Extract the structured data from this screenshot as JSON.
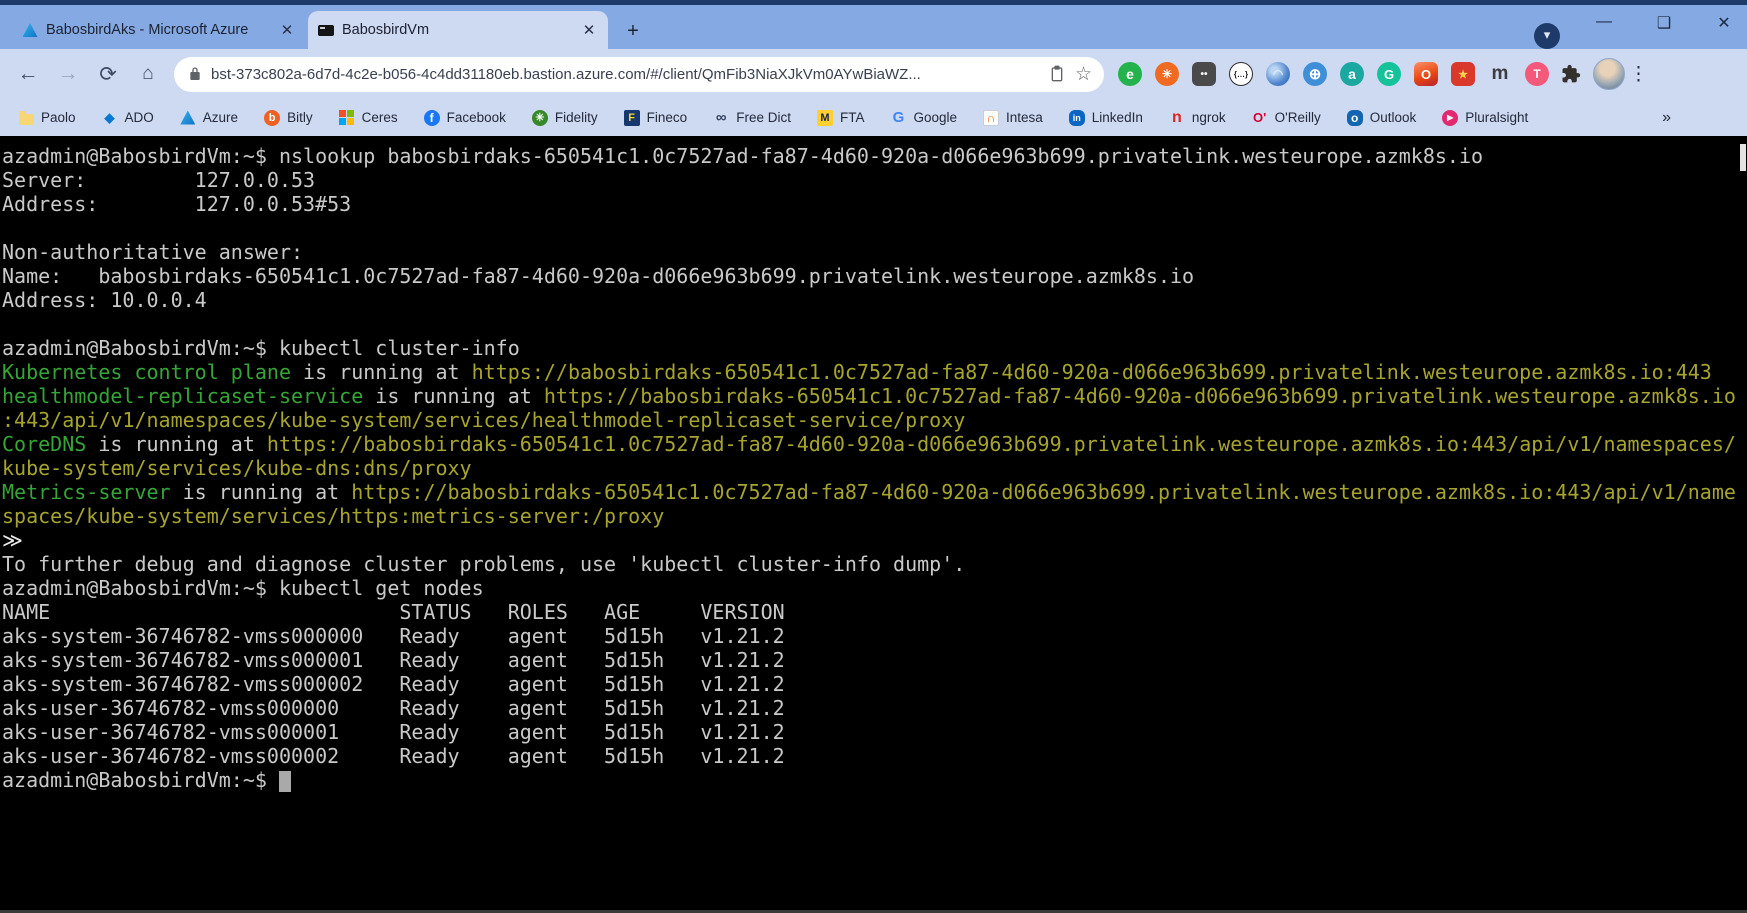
{
  "browser": {
    "tabs": [
      {
        "title": "BabosbirdAks - Microsoft Azure",
        "favicon": "azure",
        "close_glyph": "✕",
        "active": false
      },
      {
        "title": "BabosbirdVm",
        "favicon": "terminal",
        "close_glyph": "✕",
        "active": true
      }
    ],
    "new_tab_glyph": "+",
    "tab_search_glyph": "▾",
    "window_controls": {
      "minimize": "—",
      "maximize": "❑",
      "close": "✕"
    },
    "toolbar": {
      "back_glyph": "←",
      "forward_glyph": "→",
      "reload_glyph": "⟳",
      "home_glyph": "⌂",
      "url": "bst-373c802a-6d7d-4c2e-b056-4c4dd31180eb.bastion.azure.com/#/client/QmFib3NiaXJkVm0AYwBiaWZ...",
      "star_glyph": "☆"
    },
    "extensions": [
      {
        "name": "evernote-extension-icon",
        "glyph": "e",
        "bg": "#23b24b",
        "fg": "#ffffff",
        "shape": "circle",
        "size": 14
      },
      {
        "name": "orange-burst-extension-icon",
        "glyph": "✳",
        "bg": "#f06a21",
        "fg": "#ffffff",
        "shape": "circle",
        "size": 12
      },
      {
        "name": "dark-capture-extension-icon",
        "glyph": "••",
        "bg": "#4a4a4a",
        "fg": "#ffffff",
        "shape": "rounded",
        "size": 10
      },
      {
        "name": "json-formatter-extension-icon",
        "glyph": "{…}",
        "bg": "#ffffff",
        "fg": "#222222",
        "shape": "circle",
        "size": 8,
        "border": "#2b2b2b"
      },
      {
        "name": "blue-swirl-extension-icon",
        "glyph": "◠",
        "bg": "#5a90d6",
        "fg": "#dce9fa",
        "shape": "circle",
        "size": 12,
        "grad": "radial-gradient(circle at 35% 35%,#bcd6f2 15%,#4f86cf 60%,#2e5fa8)"
      },
      {
        "name": "globe-download-extension-icon",
        "glyph": "⊕",
        "bg": "#3f8fd8",
        "fg": "#ffffff",
        "shape": "circle",
        "size": 15
      },
      {
        "name": "teal-a-extension-icon",
        "glyph": "a",
        "bg": "#1ba8a0",
        "fg": "#ffffff",
        "shape": "circle",
        "size": 14
      },
      {
        "name": "grammarly-extension-icon",
        "glyph": "G",
        "bg": "#15c39a",
        "fg": "#ffffff",
        "shape": "circle",
        "size": 13
      },
      {
        "name": "office-extension-icon",
        "glyph": "O",
        "bg": "#d83b01",
        "fg": "#ffffff",
        "shape": "rounded",
        "size": 13,
        "grad": "linear-gradient(160deg,#ff8f6b,#e8490f 55%,#b72130)"
      },
      {
        "name": "red-folder-star-extension-icon",
        "glyph": "★",
        "bg": "#d9382a",
        "fg": "#ffd34d",
        "shape": "rounded",
        "size": 11
      },
      {
        "name": "medium-m-extension-icon",
        "glyph": "m",
        "bg": "transparent",
        "fg": "#3c3c43",
        "shape": "none",
        "size": 19
      },
      {
        "name": "pink-t-extension-icon",
        "glyph": "T",
        "bg": "#f4587a",
        "fg": "#ffffff",
        "shape": "circle",
        "size": 12
      }
    ],
    "bookmarks": {
      "items": [
        {
          "label": "Paolo",
          "type": "folder"
        },
        {
          "label": "ADO",
          "type": "plain",
          "glyph": "◆",
          "bg": "transparent",
          "fg": "#0078d4",
          "size": 13
        },
        {
          "label": "Azure",
          "type": "azure"
        },
        {
          "label": "Bitly",
          "type": "plain",
          "glyph": "b",
          "bg": "#ee6123",
          "fg": "#ffffff",
          "shape": "circle",
          "size": 11
        },
        {
          "label": "Ceres",
          "type": "mssquares"
        },
        {
          "label": "Facebook",
          "type": "plain",
          "glyph": "f",
          "bg": "#1877f2",
          "fg": "#ffffff",
          "shape": "circle",
          "size": 12
        },
        {
          "label": "Fidelity",
          "type": "plain",
          "glyph": "✳",
          "bg": "#368727",
          "fg": "#ffffff",
          "shape": "circle",
          "size": 11
        },
        {
          "label": "Fineco",
          "type": "plain",
          "glyph": "F",
          "bg": "#16366f",
          "fg": "#ffd41f",
          "shape": "square",
          "size": 11
        },
        {
          "label": "Free Dict",
          "type": "plain",
          "glyph": "∞",
          "bg": "transparent",
          "fg": "#31415e",
          "size": 15
        },
        {
          "label": "FTA",
          "type": "plain",
          "glyph": "M",
          "bg": "#ffd02f",
          "fg": "#17234d",
          "shape": "square",
          "size": 11
        },
        {
          "label": "Google",
          "type": "plain",
          "glyph": "G",
          "bg": "transparent",
          "fg": "#4285f4",
          "size": 15
        },
        {
          "label": "Intesa",
          "type": "plain",
          "glyph": "∩",
          "bg": "#ffffff",
          "fg": "#f06400",
          "shape": "square",
          "size": 12,
          "border": "#c9cdd6"
        },
        {
          "label": "LinkedIn",
          "type": "plain",
          "glyph": "in",
          "bg": "#0a66c2",
          "fg": "#ffffff",
          "shape": "rounded",
          "size": 9
        },
        {
          "label": "ngrok",
          "type": "plain",
          "glyph": "n",
          "bg": "transparent",
          "fg": "#e0241c",
          "size": 16
        },
        {
          "label": "O'Reilly",
          "type": "plain",
          "glyph": "O'",
          "bg": "transparent",
          "fg": "#d3002d",
          "size": 13
        },
        {
          "label": "Outlook",
          "type": "plain",
          "glyph": "o",
          "bg": "#1066b0",
          "fg": "#ffffff",
          "shape": "rounded",
          "size": 12
        },
        {
          "label": "Pluralsight",
          "type": "plain",
          "glyph": "▶",
          "bg": "#e2286e",
          "fg": "#ffffff",
          "shape": "circle",
          "size": 8
        }
      ],
      "overflow_glyph": "»"
    }
  },
  "terminal": {
    "colors": {
      "bg": "#000000",
      "fg": "#c9c9c9",
      "green": "#36a436",
      "yellow": "#a6a42f",
      "bright": "#eaeaea",
      "cursor": "#a9a9a9"
    },
    "lines": [
      {
        "segs": [
          {
            "t": "azadmin@BabosbirdVm:~$ nslookup babosbirdaks-650541c1.0c7527ad-fa87-4d60-920a-d066e963b699.privatelink.westeurope.azmk8s.io",
            "c": "fg"
          }
        ]
      },
      {
        "segs": [
          {
            "t": "Server:         127.0.0.53",
            "c": "fg"
          }
        ]
      },
      {
        "segs": [
          {
            "t": "Address:        127.0.0.53#53",
            "c": "fg"
          }
        ]
      },
      {
        "segs": []
      },
      {
        "segs": [
          {
            "t": "Non-authoritative answer:",
            "c": "fg"
          }
        ]
      },
      {
        "segs": [
          {
            "t": "Name:   babosbirdaks-650541c1.0c7527ad-fa87-4d60-920a-d066e963b699.privatelink.westeurope.azmk8s.io",
            "c": "fg"
          }
        ]
      },
      {
        "segs": [
          {
            "t": "Address: 10.0.0.4",
            "c": "fg"
          }
        ]
      },
      {
        "segs": []
      },
      {
        "segs": [
          {
            "t": "azadmin@BabosbirdVm:~$ kubectl cluster-info",
            "c": "fg"
          }
        ]
      },
      {
        "segs": [
          {
            "t": "Kubernetes control plane",
            "c": "green"
          },
          {
            "t": " is running at ",
            "c": "fg"
          },
          {
            "t": "https://babosbirdaks-650541c1.0c7527ad-fa87-4d60-920a-d066e963b699.privatelink.westeurope.azmk8s.io:443",
            "c": "yellow"
          }
        ]
      },
      {
        "segs": [
          {
            "t": "healthmodel-replicaset-service",
            "c": "green"
          },
          {
            "t": " is running at ",
            "c": "fg"
          },
          {
            "t": "https://babosbirdaks-650541c1.0c7527ad-fa87-4d60-920a-d066e963b699.privatelink.westeurope.azmk8s.io",
            "c": "yellow"
          }
        ]
      },
      {
        "segs": [
          {
            "t": ":443/api/v1/namespaces/kube-system/services/healthmodel-replicaset-service/proxy",
            "c": "yellow"
          }
        ]
      },
      {
        "segs": [
          {
            "t": "CoreDNS",
            "c": "green"
          },
          {
            "t": " is running at ",
            "c": "fg"
          },
          {
            "t": "https://babosbirdaks-650541c1.0c7527ad-fa87-4d60-920a-d066e963b699.privatelink.westeurope.azmk8s.io:443/api/v1/namespaces/",
            "c": "yellow"
          }
        ]
      },
      {
        "segs": [
          {
            "t": "kube-system/services/kube-dns:dns/proxy",
            "c": "yellow"
          }
        ]
      },
      {
        "segs": [
          {
            "t": "Metrics-server",
            "c": "green"
          },
          {
            "t": " is running at ",
            "c": "fg"
          },
          {
            "t": "https://babosbirdaks-650541c1.0c7527ad-fa87-4d60-920a-d066e963b699.privatelink.westeurope.azmk8s.io:443/api/v1/name",
            "c": "yellow"
          }
        ]
      },
      {
        "segs": [
          {
            "t": "spaces/kube-system/services/https:metrics-server:/proxy",
            "c": "yellow"
          }
        ]
      },
      {
        "segs": [
          {
            "t": "≫",
            "c": "bright"
          }
        ]
      },
      {
        "segs": [
          {
            "t": "To further debug and diagnose cluster problems, use 'kubectl cluster-info dump'.",
            "c": "fg"
          }
        ]
      },
      {
        "segs": [
          {
            "t": "azadmin@BabosbirdVm:~$ kubectl get nodes",
            "c": "fg"
          }
        ]
      },
      {
        "segs": [
          {
            "t": "NAME                             STATUS   ROLES   AGE     VERSION",
            "c": "fg"
          }
        ]
      },
      {
        "segs": [
          {
            "t": "aks-system-36746782-vmss000000   Ready    agent   5d15h   v1.21.2",
            "c": "fg"
          }
        ]
      },
      {
        "segs": [
          {
            "t": "aks-system-36746782-vmss000001   Ready    agent   5d15h   v1.21.2",
            "c": "fg"
          }
        ]
      },
      {
        "segs": [
          {
            "t": "aks-system-36746782-vmss000002   Ready    agent   5d15h   v1.21.2",
            "c": "fg"
          }
        ]
      },
      {
        "segs": [
          {
            "t": "aks-user-36746782-vmss000000     Ready    agent   5d15h   v1.21.2",
            "c": "fg"
          }
        ]
      },
      {
        "segs": [
          {
            "t": "aks-user-36746782-vmss000001     Ready    agent   5d15h   v1.21.2",
            "c": "fg"
          }
        ]
      },
      {
        "segs": [
          {
            "t": "aks-user-36746782-vmss000002     Ready    agent   5d15h   v1.21.2",
            "c": "fg"
          }
        ]
      },
      {
        "segs": [
          {
            "t": "azadmin@BabosbirdVm:~$ ",
            "c": "fg"
          }
        ],
        "cursor": true
      }
    ]
  }
}
